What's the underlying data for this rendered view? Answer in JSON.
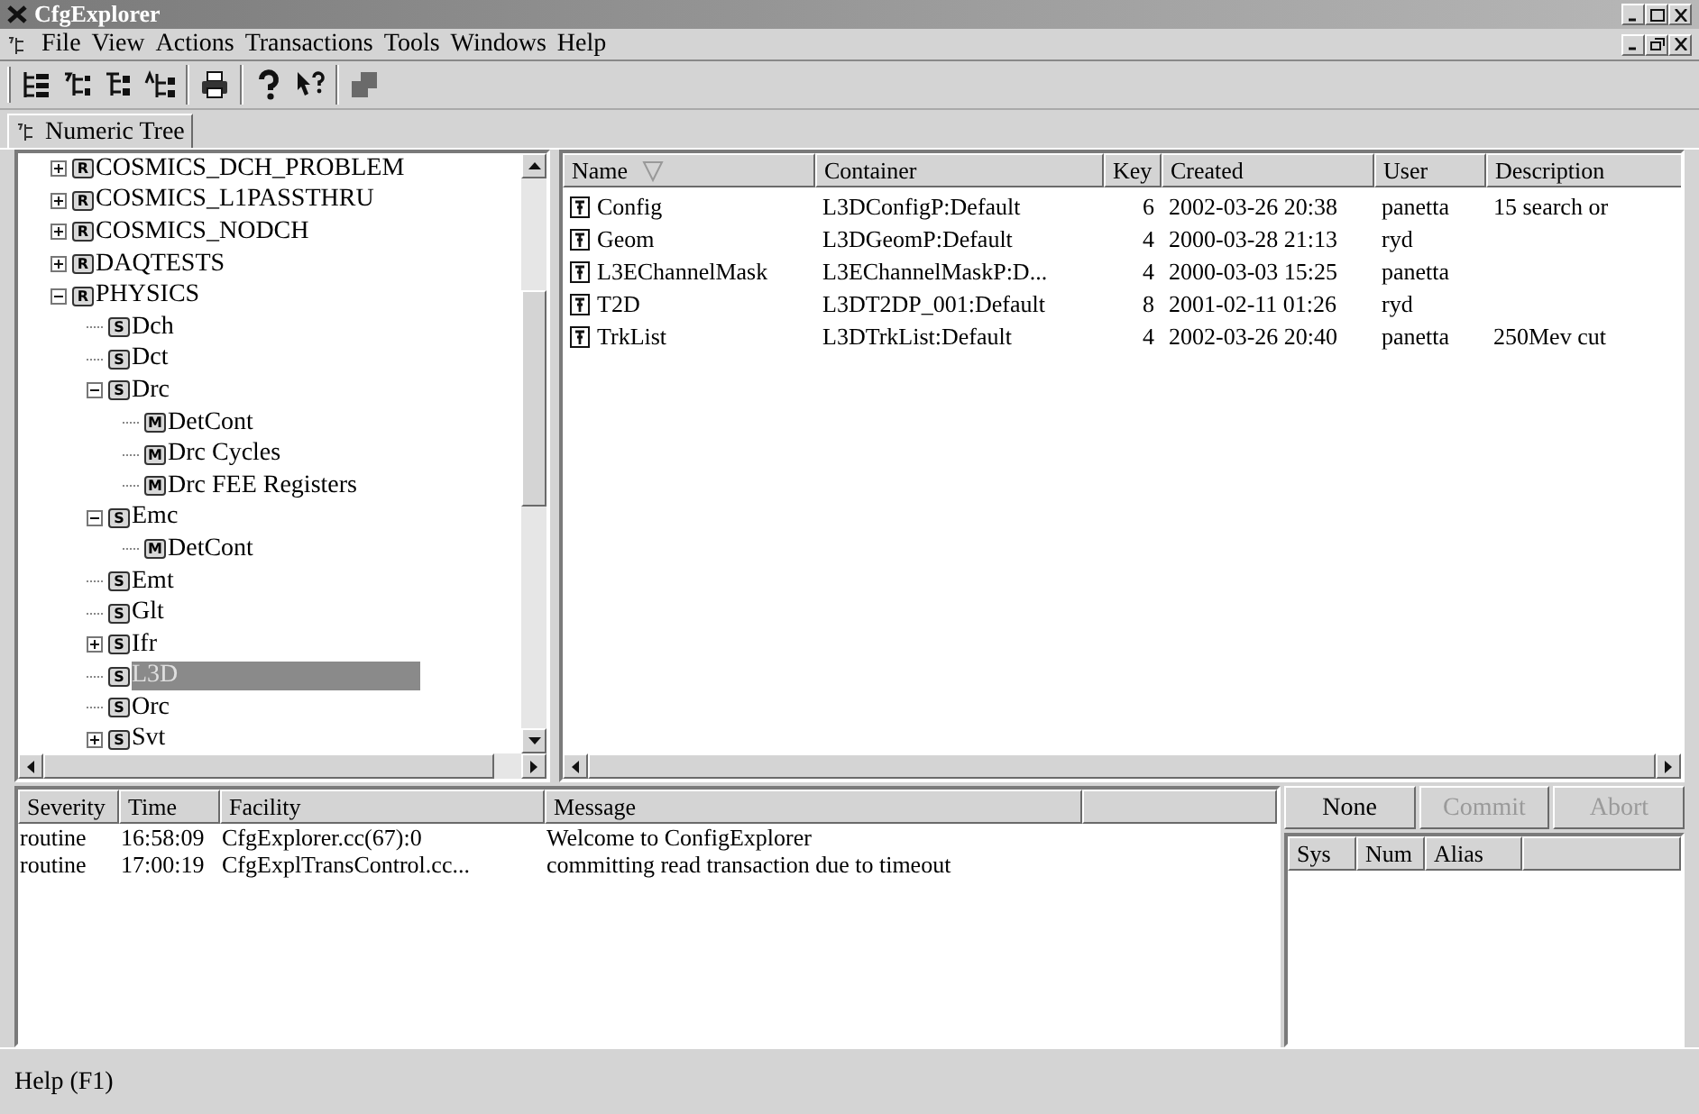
{
  "window": {
    "title": "CfgExplorer"
  },
  "menu": [
    "File",
    "View",
    "Actions",
    "Transactions",
    "Tools",
    "Windows",
    "Help"
  ],
  "toolbar": [
    {
      "kind": "tree"
    },
    {
      "kind": "numeric"
    },
    {
      "kind": "alpha"
    },
    {
      "kind": "alpha2"
    },
    {
      "kind": "sep"
    },
    {
      "kind": "print"
    },
    {
      "kind": "sep"
    },
    {
      "kind": "help"
    },
    {
      "kind": "whatsthis"
    },
    {
      "kind": "sep"
    },
    {
      "kind": "window"
    }
  ],
  "tabs": [
    {
      "label": "Numeric Tree",
      "selected": true
    }
  ],
  "tree": [
    {
      "label": "COSMICS_DCH_PROBLEM",
      "type": "R",
      "kind": "folder",
      "expanded": false,
      "selected": false
    },
    {
      "label": "COSMICS_L1PASSTHRU",
      "type": "R",
      "kind": "folder",
      "expanded": false,
      "selected": false
    },
    {
      "label": "COSMICS_NODCH",
      "type": "R",
      "kind": "folder",
      "expanded": false,
      "selected": false
    },
    {
      "label": "DAQTESTS",
      "type": "R",
      "kind": "folder",
      "expanded": false,
      "selected": false
    },
    {
      "label": "PHYSICS",
      "type": "R",
      "kind": "folder",
      "expanded": true,
      "selected": false,
      "children": [
        {
          "label": "Dch",
          "type": "S",
          "kind": "leaf",
          "selected": false
        },
        {
          "label": "Dct",
          "type": "S",
          "kind": "leaf",
          "selected": false
        },
        {
          "label": "Drc",
          "type": "S",
          "kind": "folder",
          "expanded": true,
          "selected": false,
          "children": [
            {
              "label": "DetCont",
              "type": "M",
              "kind": "leaf",
              "selected": false
            },
            {
              "label": "Drc Cycles",
              "type": "M",
              "kind": "leaf",
              "selected": false
            },
            {
              "label": "Drc FEE Registers",
              "type": "M",
              "kind": "leaf",
              "selected": false
            }
          ]
        },
        {
          "label": "Emc",
          "type": "S",
          "kind": "folder",
          "expanded": true,
          "selected": false,
          "children": [
            {
              "label": "DetCont",
              "type": "M",
              "kind": "leaf",
              "selected": false
            }
          ]
        },
        {
          "label": "Emt",
          "type": "S",
          "kind": "leaf",
          "selected": false
        },
        {
          "label": "Glt",
          "type": "S",
          "kind": "leaf",
          "selected": false
        },
        {
          "label": "Ifr",
          "type": "S",
          "kind": "folder",
          "expanded": false,
          "selected": false
        },
        {
          "label": "L3D",
          "type": "S",
          "kind": "leaf",
          "selected": true
        },
        {
          "label": "Orc",
          "type": "S",
          "kind": "leaf",
          "selected": false
        },
        {
          "label": "Svt",
          "type": "S",
          "kind": "folder",
          "expanded": false,
          "selected": false
        }
      ]
    }
  ],
  "list": {
    "columns": [
      "Name",
      "Container",
      "Key",
      "Created",
      "User",
      "Description"
    ],
    "rows": [
      [
        "Config",
        "L3DConfigP:Default",
        "6",
        "2002-03-26 20:38",
        "panetta",
        "15 search or"
      ],
      [
        "Geom",
        "L3DGeomP:Default",
        "4",
        "2000-03-28 21:13",
        "ryd",
        ""
      ],
      [
        "L3EChannelMask",
        "L3EChannelMaskP:D...",
        "4",
        "2000-03-03 15:25",
        "panetta",
        ""
      ],
      [
        "T2D",
        "L3DT2DP_001:Default",
        "8",
        "2001-02-11 01:26",
        "ryd",
        ""
      ],
      [
        "TrkList",
        "L3DTrkList:Default",
        "4",
        "2002-03-26 20:40",
        "panetta",
        "250Mev cut"
      ]
    ]
  },
  "log": {
    "columns": [
      "Severity",
      "Time",
      "Facility",
      "Message"
    ],
    "rows": [
      [
        "routine",
        "16:58:09",
        "CfgExplorer.cc(67):0",
        "Welcome to ConfigExplorer"
      ],
      [
        "routine",
        "17:00:19",
        "CfgExplTransControl.cc...",
        "committing read transaction due to timeout"
      ]
    ]
  },
  "transaction_buttons": [
    {
      "label": "None",
      "disabled": false
    },
    {
      "label": "Commit",
      "disabled": true
    },
    {
      "label": "Abort",
      "disabled": true
    }
  ],
  "transaction_table": {
    "columns": [
      "Sys",
      "Num",
      "Alias"
    ]
  },
  "status_bar": "Help (F1)"
}
